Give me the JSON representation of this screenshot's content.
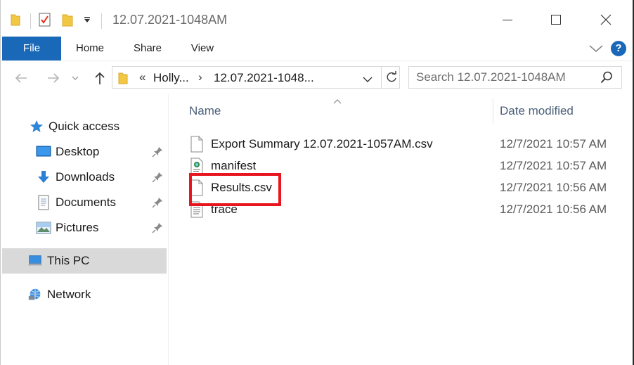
{
  "window": {
    "title": "12.07.2021-1048AM",
    "minimize_label": "Minimize",
    "maximize_label": "Maximize",
    "close_label": "Close"
  },
  "ribbon": {
    "tabs": [
      "File",
      "Home",
      "Share",
      "View"
    ],
    "help": "?",
    "accent_color": "#1a68b8"
  },
  "address": {
    "overflow": "«",
    "crumbs": [
      "Holly...",
      "12.07.2021-1048..."
    ],
    "separator": "›"
  },
  "search": {
    "placeholder": "Search 12.07.2021-1048AM"
  },
  "nav": {
    "items": [
      {
        "label": "Quick access",
        "icon": "star-icon",
        "pinned": false
      },
      {
        "label": "Desktop",
        "icon": "desktop-icon",
        "pinned": true
      },
      {
        "label": "Downloads",
        "icon": "download-icon",
        "pinned": true
      },
      {
        "label": "Documents",
        "icon": "documents-icon",
        "pinned": true
      },
      {
        "label": "Pictures",
        "icon": "pictures-icon",
        "pinned": true
      },
      {
        "label": "This PC",
        "icon": "computer-icon",
        "pinned": false,
        "selected": true
      },
      {
        "label": "Network",
        "icon": "network-icon",
        "pinned": false
      }
    ]
  },
  "columns": {
    "name": "Name",
    "date_modified": "Date modified"
  },
  "files": [
    {
      "name": "Export Summary 12.07.2021-1057AM.csv",
      "date": "12/7/2021 10:57 AM",
      "icon": "file-icon"
    },
    {
      "name": "manifest",
      "date": "12/7/2021 10:57 AM",
      "icon": "xml-file-icon"
    },
    {
      "name": "Results.csv",
      "date": "12/7/2021 10:56 AM",
      "icon": "file-icon",
      "highlighted": true
    },
    {
      "name": "trace",
      "date": "12/7/2021 10:56 AM",
      "icon": "text-file-icon"
    }
  ],
  "highlight_color": "#e8141e"
}
